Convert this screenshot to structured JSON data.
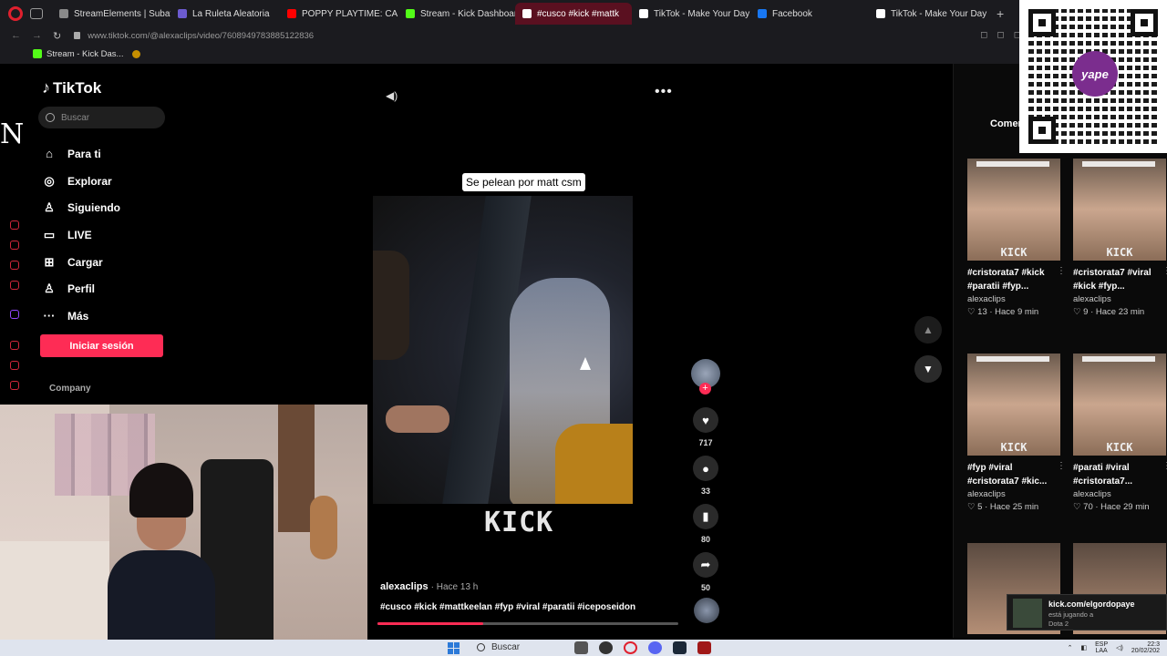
{
  "browser": {
    "tabs": [
      {
        "label": "StreamElements | Subatho",
        "color": "#8a8a8a",
        "active": false
      },
      {
        "label": "La Ruleta Aleatoria",
        "color": "#6c5bd0",
        "active": false
      },
      {
        "label": "POPPY PLAYTIME: CAPÍT",
        "color": "#ff0000",
        "active": false
      },
      {
        "label": "Stream - Kick Dashboard",
        "color": "#53fc18",
        "active": false
      },
      {
        "label": "#cusco #kick #mattk",
        "color": "#ffffff",
        "active": true
      },
      {
        "label": "TikTok - Make Your Day",
        "color": "#ffffff",
        "active": false
      },
      {
        "label": "Facebook",
        "color": "#1877f2",
        "active": false
      },
      {
        "label": "TikTok - Make Your Day",
        "color": "#ffffff",
        "active": false
      }
    ],
    "url": "www.tiktok.com/@alexaclips/video/7608949783885122836",
    "bookmark": "Stream - Kick Das..."
  },
  "tiktok": {
    "logo": "TikTok",
    "search_placeholder": "Buscar",
    "nav": [
      {
        "icon": "home-icon",
        "glyph": "⌂",
        "label": "Para ti"
      },
      {
        "icon": "compass-icon",
        "glyph": "◎",
        "label": "Explorar"
      },
      {
        "icon": "following-icon",
        "glyph": "♙",
        "label": "Siguiendo"
      },
      {
        "icon": "live-icon",
        "glyph": "▭",
        "label": "LIVE"
      },
      {
        "icon": "upload-icon",
        "glyph": "⊞",
        "label": "Cargar"
      },
      {
        "icon": "profile-icon",
        "glyph": "♙",
        "label": "Perfil"
      },
      {
        "icon": "more-icon",
        "glyph": "···",
        "label": "Más"
      }
    ],
    "login_button": "Iniciar sesión",
    "company": "Company"
  },
  "video": {
    "caption": "Se pelean por matt csm",
    "watermark": "KICK",
    "author": "alexaclips",
    "time": "· Hace 13 h",
    "hashtags": "#cusco #kick #mattkeelan #fyp #viral #paratii #iceposeidon",
    "progress": 0.35,
    "likes": "717",
    "comments": "33",
    "saves": "80",
    "shares": "50"
  },
  "side": {
    "comments_tab": "Comen",
    "qr_brand": "yape",
    "cards": [
      {
        "title": "#cristorata7 #kick\n#paratii #fyp...",
        "user": "alexaclips",
        "stats": "♡ 13 · Hace 9 min"
      },
      {
        "title": "#cristorata7 #viral\n#kick #fyp...",
        "user": "alexaclips",
        "stats": "♡ 9 · Hace 23 min"
      },
      {
        "title": "#fyp #viral\n#cristorata7 #kic...",
        "user": "alexaclips",
        "stats": "♡ 5 · Hace 25 min"
      },
      {
        "title": "#parati #viral\n#cristorata7...",
        "user": "alexaclips",
        "stats": "♡ 70 · Hace 29 min"
      }
    ],
    "card_watermark": "KICK",
    "toast_title": "kick.com/elgordopaye",
    "toast_sub1": "está jugando a",
    "toast_sub2": "Dota 2"
  },
  "taskbar": {
    "search": "Buscar",
    "lang1": "ESP",
    "lang2": "LAA",
    "time": "22:3",
    "date": "20/02/202"
  },
  "overlay": {
    "letter": "N"
  }
}
